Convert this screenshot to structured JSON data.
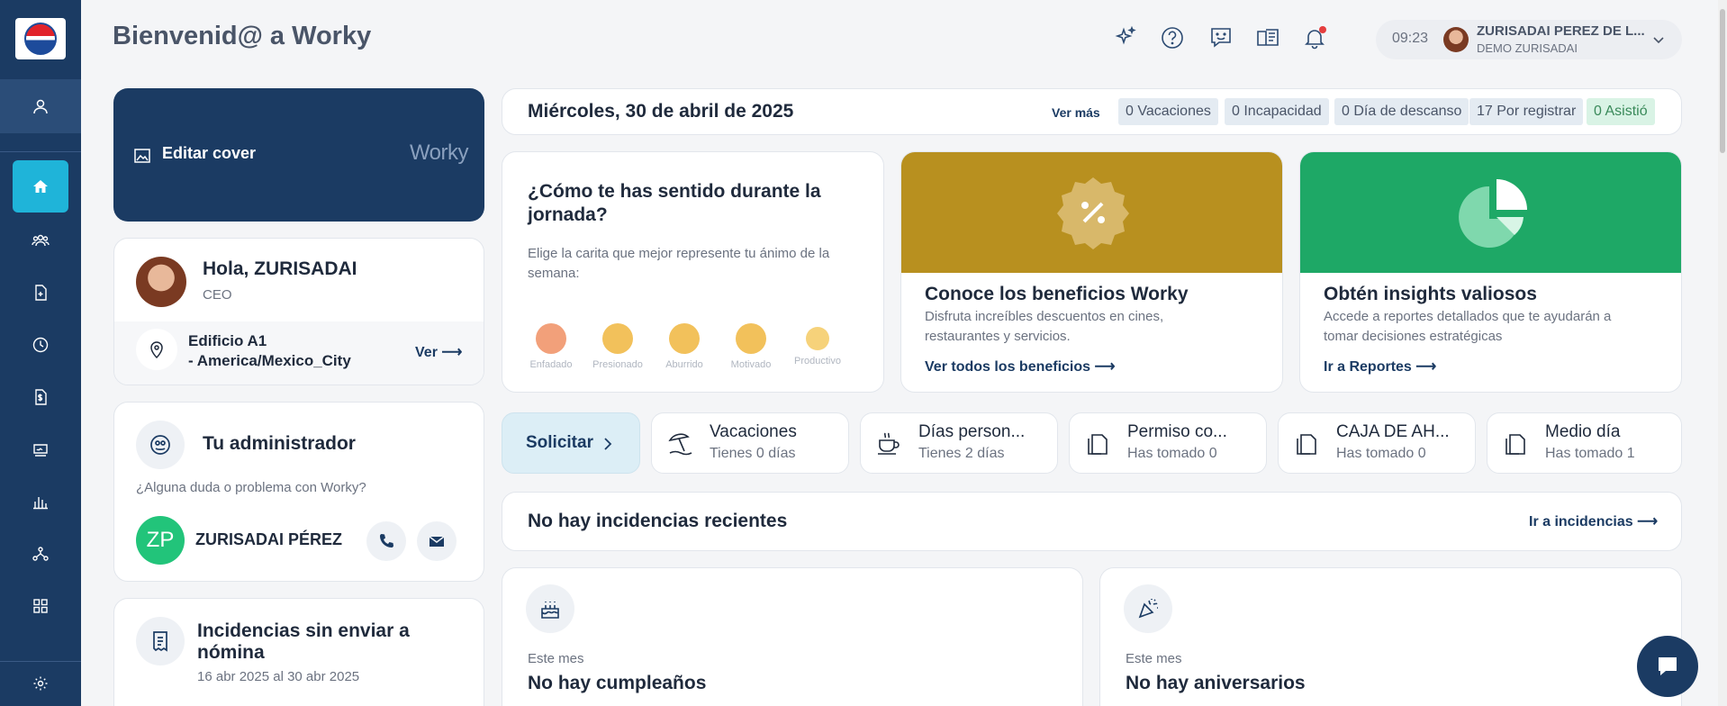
{
  "header": {
    "title": "Bienvenid@ a Worky",
    "time": "09:23",
    "user_name": "ZURISADAI PEREZ DE L...",
    "company": "DEMO ZURISADAI"
  },
  "cover": {
    "edit_label": "Editar cover",
    "brand": "Worky"
  },
  "profile": {
    "greeting": "Hola, ZURISADAI",
    "role": "CEO",
    "location_line1": "Edificio A1",
    "location_line2": "- America/Mexico_City",
    "location_link": "Ver"
  },
  "admin": {
    "title": "Tu administrador",
    "question": "¿Alguna duda o problema con Worky?",
    "initials": "ZP",
    "name": "ZURISADAI PÉREZ"
  },
  "incidences_pending": {
    "title_line1": "Incidencias sin enviar a",
    "title_line2": "nómina",
    "range": "16 abr 2025 al 30 abr 2025"
  },
  "date_bar": {
    "date": "Miércoles, 30 de abril de 2025",
    "more": "Ver más",
    "pills": [
      "0 Vacaciones",
      "0 Incapacidad",
      "0 Día de descanso",
      "17 Por registrar",
      "0 Asistió"
    ]
  },
  "mood": {
    "title_line1": "¿Cómo te has sentido durante la",
    "title_line2": "jornada?",
    "subtitle_line1": "Elige la carita que mejor represente tu ánimo de la",
    "subtitle_line2": "semana:",
    "options": [
      "Enfadado",
      "Presionado",
      "Aburrido",
      "Motivado",
      "Productivo"
    ]
  },
  "benefits": {
    "title": "Conoce los beneficios Worky",
    "desc_line1": "Disfruta increíbles descuentos en cines,",
    "desc_line2": "restaurantes y servicios.",
    "link": "Ver todos los beneficios",
    "color": "#b8901f"
  },
  "insights": {
    "title": "Obtén insights valiosos",
    "desc_line1": "Accede a reportes detallados que te ayudarán a",
    "desc_line2": "tomar decisiones estratégicas",
    "link": "Ir a Reportes",
    "color": "#1ea866"
  },
  "requests": {
    "solicitar": "Solicitar",
    "items": [
      {
        "title": "Vacaciones",
        "sub": "Tienes 0 días"
      },
      {
        "title": "Días person...",
        "sub": "Tienes 2 días"
      },
      {
        "title": "Permiso co...",
        "sub": "Has tomado 0"
      },
      {
        "title": "CAJA DE AH...",
        "sub": "Has tomado 0"
      },
      {
        "title": "Medio día",
        "sub": "Has tomado 1"
      }
    ]
  },
  "incidences": {
    "title": "No hay incidencias recientes",
    "link": "Ir a incidencias"
  },
  "birthdays": {
    "period": "Este mes",
    "text": "No hay cumpleaños"
  },
  "anniversaries": {
    "period": "Este mes",
    "text": "No hay aniversarios"
  }
}
